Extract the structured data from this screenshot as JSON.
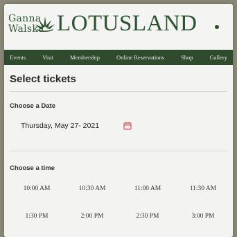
{
  "brand": {
    "ganna_walska": "Ganna\nWalska",
    "name": "LOTUSLAND"
  },
  "nav": [
    "Events",
    "Visit",
    "Membership",
    "Online Reservations",
    "Shop",
    "Gallery"
  ],
  "page": {
    "title": "Select tickets",
    "date_section_label": "Choose a Date",
    "selected_date": "Thursday, May 27- 2021",
    "time_section_label": "Choose a time",
    "times": [
      "10:00 AM",
      "10:30 AM",
      "11:00 AM",
      "11:30 AM",
      "1:30 PM",
      "2:00 PM",
      "2:30 PM",
      "3:00 PM"
    ]
  },
  "colors": {
    "brand_green": "#2b5330",
    "nav_bg": "#2f4a2c",
    "calendar_icon": "#d9534f"
  },
  "icons": {
    "logo": "lotus-leaf-icon",
    "calendar": "calendar-icon"
  }
}
